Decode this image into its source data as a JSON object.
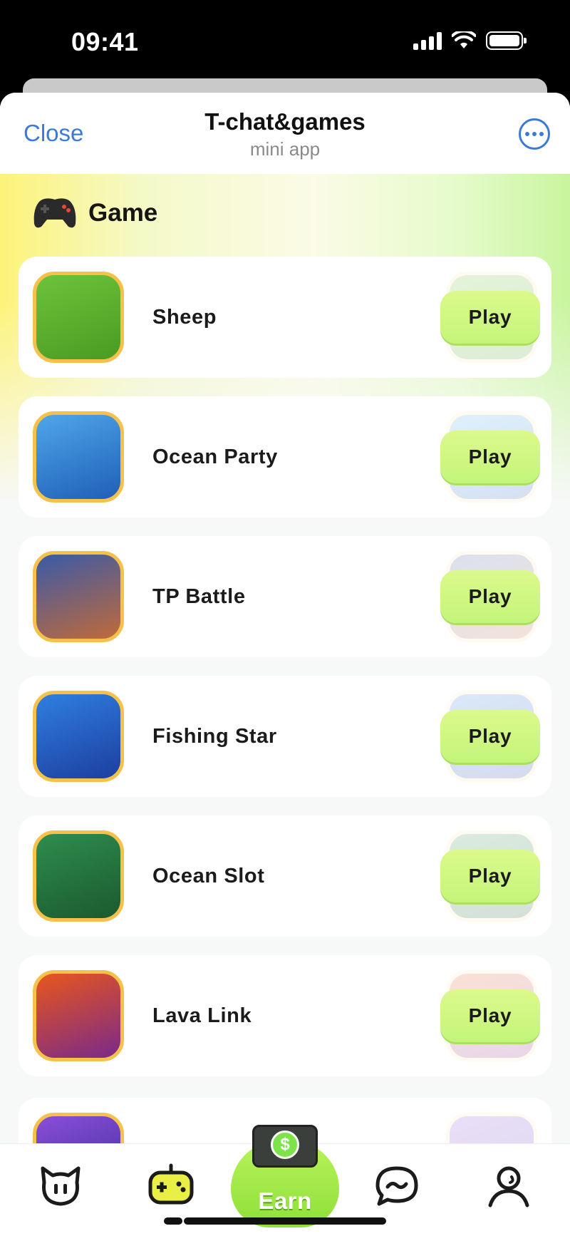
{
  "status": {
    "time": "09:41"
  },
  "header": {
    "close_label": "Close",
    "title": "T-chat&games",
    "subtitle": "mini app",
    "more_icon": "more-horizontal-icon"
  },
  "section": {
    "title": "Game",
    "icon": "gamepad-icon"
  },
  "games": [
    {
      "name": "Sheep",
      "play_label": "Play",
      "icon": "sheep-game-icon",
      "colors": [
        "#6cc33a",
        "#4a9b22"
      ]
    },
    {
      "name": "Ocean Party",
      "play_label": "Play",
      "icon": "shark-game-icon",
      "colors": [
        "#4fa6e8",
        "#1f5fb8"
      ]
    },
    {
      "name": "TP Battle",
      "play_label": "Play",
      "icon": "royal-couple-game-icon",
      "colors": [
        "#3a5aa8",
        "#c06a3a"
      ]
    },
    {
      "name": "Fishing Star",
      "play_label": "Play",
      "icon": "fishing-star-game-icon",
      "colors": [
        "#2f7fe0",
        "#1c3fa0"
      ]
    },
    {
      "name": "Ocean Slot",
      "play_label": "Play",
      "icon": "crown-slot-game-icon",
      "colors": [
        "#2e8d4e",
        "#1b5a2e"
      ]
    },
    {
      "name": "Lava Link",
      "play_label": "Play",
      "icon": "lava-link-game-icon",
      "colors": [
        "#e8561c",
        "#7a2a8a"
      ]
    }
  ],
  "tabbar": {
    "earn_label": "Earn",
    "tabs": [
      "cat-home-icon",
      "gamepad-tab-icon",
      "chat-bubble-icon",
      "profile-icon"
    ]
  }
}
